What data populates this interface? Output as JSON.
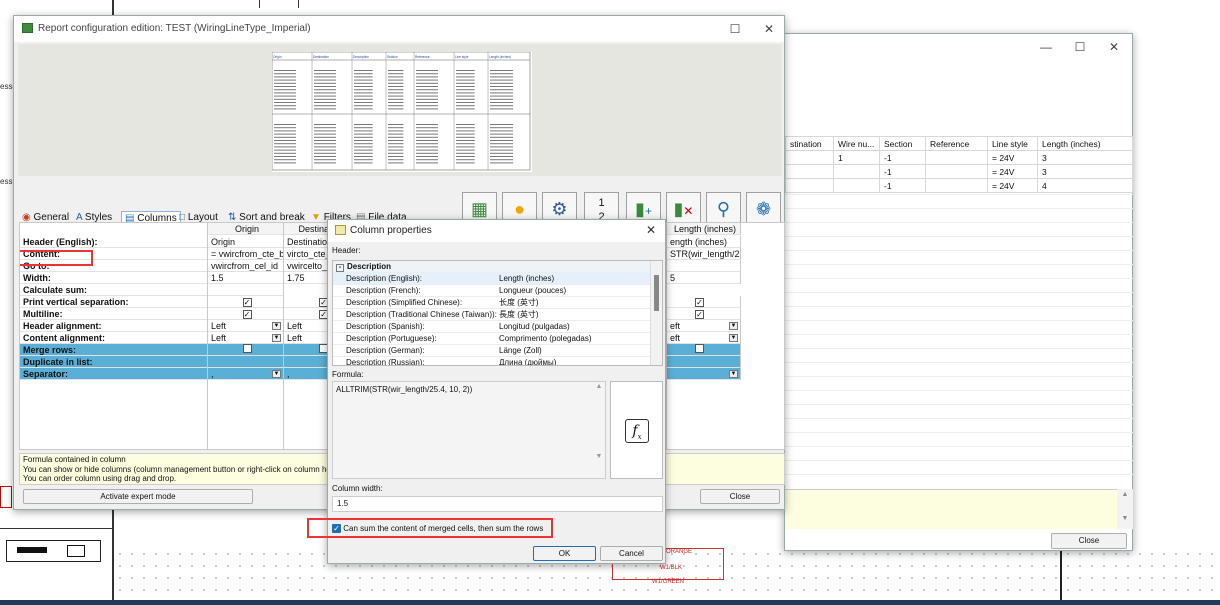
{
  "bg": {
    "labels": [
      "esse",
      "esse"
    ],
    "wire_labels": [
      "ORANGE",
      "W1/BLK",
      "W1/GREEN"
    ]
  },
  "right_window": {
    "columns": [
      "stination",
      "Wire nu...",
      "Section",
      "Reference",
      "Line style",
      "Length (inches)"
    ],
    "rows": [
      [
        "",
        "1",
        "-1",
        "",
        "= 24V",
        "3"
      ],
      [
        "",
        "",
        "-1",
        "",
        "= 24V",
        "3"
      ],
      [
        "",
        "",
        "-1",
        "",
        "= 24V",
        "4"
      ]
    ],
    "close_label": "Close"
  },
  "main": {
    "title": "Report configuration edition: TEST (WiringLineType_Imperial)",
    "tabs": [
      "General",
      "Styles",
      "Columns",
      "Layout",
      "Sort and break",
      "Filters",
      "File data"
    ],
    "toolbar_icons": [
      "table-icon",
      "lightbulb-icon",
      "settings-icon",
      "numbering-icon",
      "add-column-icon",
      "delete-column-icon",
      "preview-icon",
      "plugin-icon"
    ],
    "props": [
      "Header (English):",
      "Content:",
      "Go to:",
      "Width:",
      "Calculate sum:",
      "Print vertical separation:",
      "Multiline:",
      "Header alignment:",
      "Content alignment:",
      "Merge rows:",
      "Duplicate in list:",
      "Separator:"
    ],
    "col_headers": [
      "Origin",
      "Destinat",
      "Length (inches)"
    ],
    "origin_col": [
      "Origin",
      "= vwircfrom_cte_bi",
      "vwircfrom_cel_id",
      "1.5",
      "",
      "",
      "",
      "Left",
      "Left",
      "",
      "",
      ","
    ],
    "dest_col": [
      "Destination",
      "vircto_cte_",
      "vwircelto_",
      "1.75",
      "",
      "",
      "",
      "Left",
      "Left",
      "",
      "",
      ","
    ],
    "length_col": [
      "ength (inches)",
      "STR(wir_length/25.4",
      "",
      "5",
      "",
      "",
      "",
      "eft",
      "eft",
      "",
      "",
      ""
    ],
    "info_lines": [
      "Formula contained in column",
      "You can show or hide columns (column management button or right-click on column hea",
      "You can order column using drag and drop."
    ],
    "expert_button": "Activate expert mode",
    "close_button": "Close",
    "preview_headers": [
      "Origin",
      "Destination",
      "Description",
      "Section",
      "Reference",
      "Line style",
      "Length (inches)"
    ]
  },
  "dialog": {
    "title": "Column properties",
    "header_label": "Header:",
    "group_label": "Description",
    "rows": [
      {
        "name": "Description (English):",
        "value": "Length (inches)"
      },
      {
        "name": "Description (French):",
        "value": "Longueur (pouces)"
      },
      {
        "name": "Description (Simplified Chinese):",
        "value": "长度 (英寸)"
      },
      {
        "name": "Description (Traditional Chinese (Taiwan)):",
        "value": "長度 (英寸)"
      },
      {
        "name": "Description (Spanish):",
        "value": "Longitud (pulgadas)"
      },
      {
        "name": "Description (Portuguese):",
        "value": "Comprimento (polegadas)"
      },
      {
        "name": "Description (German):",
        "value": "Länge (Zoll)"
      },
      {
        "name": "Description (Russian):",
        "value": "Длина (дюймы)"
      }
    ],
    "formula_label": "Formula:",
    "formula": "ALLTRIM(STR(wir_length/25.4, 10, 2))",
    "width_label": "Column width:",
    "width_value": "1.5",
    "checkbox_label": "Can sum the content of merged cells, then sum the rows",
    "ok": "OK",
    "cancel": "Cancel"
  }
}
